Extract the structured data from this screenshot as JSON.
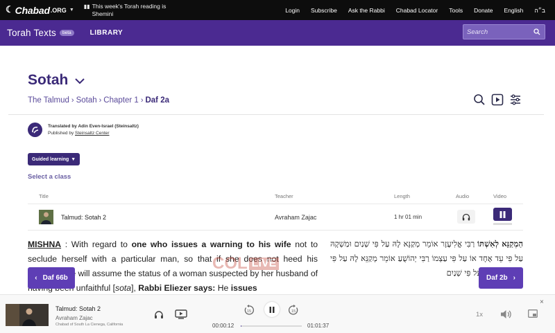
{
  "topbar": {
    "logo_mark": "☾",
    "logo_text": "Chabad",
    "logo_org": ".ORG",
    "notice": "This week's Torah reading is Shemini",
    "nav": [
      "Login",
      "Subscribe",
      "Ask the Rabbi",
      "Chabad Locator",
      "Tools",
      "Donate",
      "English",
      "ב״ה"
    ]
  },
  "appbar": {
    "brand": "Torah Texts",
    "beta": "beta",
    "library": "LIBRARY",
    "search_placeholder": "Search"
  },
  "page": {
    "title": "Sotah",
    "breadcrumb": [
      "The Talmud",
      "Sotah",
      "Chapter 1",
      "Daf 2a"
    ]
  },
  "translator": {
    "line1": "Translated by Adin Even-Israel (Steinsaltz)",
    "published_prefix": "Published by ",
    "publisher": "Steinsaltz Center"
  },
  "classes": {
    "guided_label": "Guided learning",
    "select_label": "Select a class",
    "headers": {
      "title": "Title",
      "teacher": "Teacher",
      "length": "Length",
      "audio": "Audio",
      "video": "Video"
    },
    "rows": [
      {
        "title": "Talmud: Sotah 2",
        "teacher": "Avraham Zajac",
        "length": "1 hr 01 min"
      }
    ]
  },
  "text": {
    "mishna_label": "MISHNA",
    "p1": " : With regard to ",
    "b1": "one who issues a warning to his wife",
    "p2": " not to seclude herself with a particular man, so that if she does not heed his warning, she will assume the status of a woman suspected by her husband of having been unfaithful [",
    "sota": "sota",
    "p3": "], ",
    "b2": "Rabbi Eliezer says:",
    "p4": " He ",
    "b3": "issues",
    "hebrew_bold": "הַמְקַנֵּא לְאִשְׁתּוֹ",
    "hebrew_rest": " רַבִּי אֱלִיעֶזֶר אוֹמֵר מְקַנֵּא לָהּ עַל פִּי שְׁנַיִם וּמַשְׁקָהּ עַל פִּי עֵד אֶחָד אוֹ עַל פִּי עַצְמוֹ רַבִּי יְהוֹשֻׁעַ אוֹמֵר מְקַנֵּא לָהּ עַל פִּי שְׁנַיִם וּמַשְׁקָהּ עַל פִּי שְׁנַיִם"
  },
  "watermark": {
    "col": "COL",
    "live": "LIVE"
  },
  "daf_nav": {
    "prev": "Daf 66b",
    "next": "Daf 2b"
  },
  "player": {
    "title": "Talmud: Sotah 2",
    "teacher": "Avraham Zajac",
    "org": "Chabad of South La Cienega, California",
    "time_elapsed": "00:00:12",
    "time_total": "01:01:37",
    "progress": 0.003,
    "skip_back": "15",
    "skip_fwd": "15",
    "speed": "1x",
    "close": "×"
  },
  "colors": {
    "accent": "#4b2a91",
    "button": "#5e3eb5",
    "title": "#3b2a78"
  }
}
